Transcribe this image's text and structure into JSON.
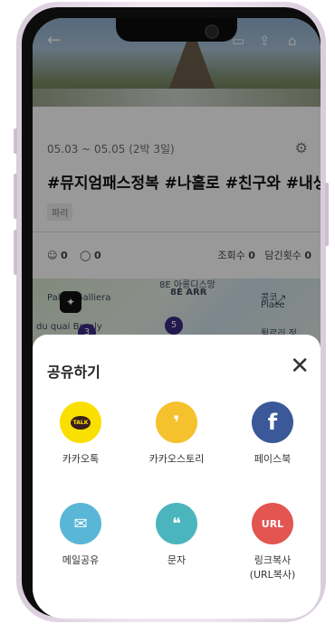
{
  "trip": {
    "dates": "05.03 ~ 05.05 (2박 3일)",
    "title": "#뮤지엄패스정복 #나홀로 #친구와 #내생",
    "tag": "파리"
  },
  "stats": {
    "likes": "0",
    "comments": "0",
    "views_label": "조회수",
    "views": "0",
    "saves_label": "담긴횟수",
    "saves": "0"
  },
  "map": {
    "labels": [
      "8E ARR",
      "Palais Galliera",
      "du quai Branly",
      "콩코",
      "Place",
      "튈르리 정",
      "8E 아롱디스망"
    ],
    "pins": [
      "3",
      "5"
    ]
  },
  "share": {
    "title": "공유하기",
    "options": [
      {
        "label": "카카오톡",
        "icon": "kakaotalk-icon",
        "color": "#f9e000",
        "glyph": "TALK"
      },
      {
        "label": "카카오스토리",
        "icon": "kakaostory-icon",
        "color": "#f5c12d",
        "glyph": "9"
      },
      {
        "label": "페이스북",
        "icon": "facebook-icon",
        "color": "#3b5998",
        "glyph": "f"
      },
      {
        "label": "메일공유",
        "icon": "mail-icon",
        "color": "#5ab6d6",
        "glyph": "✉"
      },
      {
        "label": "문자",
        "icon": "message-icon",
        "color": "#4bb5bd",
        "glyph": "💬"
      },
      {
        "label": "링크복사\n(URL복사)",
        "icon": "link-icon",
        "color": "#e25550",
        "glyph": "URL"
      }
    ]
  }
}
